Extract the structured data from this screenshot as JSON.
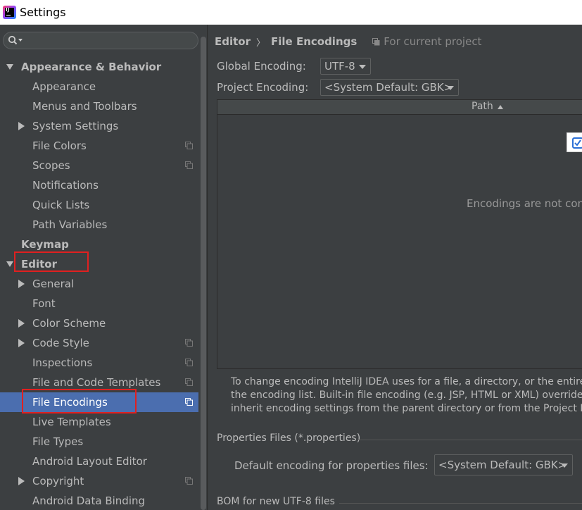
{
  "window": {
    "title": "Settings"
  },
  "search": {
    "placeholder": ""
  },
  "sidebar": {
    "items": [
      {
        "label": "Appearance & Behavior",
        "level": 0,
        "expanded": true,
        "bold": true
      },
      {
        "label": "Appearance",
        "level": 1
      },
      {
        "label": "Menus and Toolbars",
        "level": 1
      },
      {
        "label": "System Settings",
        "level": 1,
        "collapsed": true
      },
      {
        "label": "File Colors",
        "level": 1,
        "project_icon": true
      },
      {
        "label": "Scopes",
        "level": 1,
        "project_icon": true
      },
      {
        "label": "Notifications",
        "level": 1
      },
      {
        "label": "Quick Lists",
        "level": 1
      },
      {
        "label": "Path Variables",
        "level": 1
      },
      {
        "label": "Keymap",
        "level": 0,
        "bold": true
      },
      {
        "label": "Editor",
        "level": 0,
        "expanded": true,
        "bold": true,
        "highlighted": true
      },
      {
        "label": "General",
        "level": 1,
        "collapsed": true
      },
      {
        "label": "Font",
        "level": 1
      },
      {
        "label": "Color Scheme",
        "level": 1,
        "collapsed": true
      },
      {
        "label": "Code Style",
        "level": 1,
        "collapsed": true,
        "project_icon": true
      },
      {
        "label": "Inspections",
        "level": 1,
        "project_icon": true
      },
      {
        "label": "File and Code Templates",
        "level": 1,
        "project_icon": true
      },
      {
        "label": "File Encodings",
        "level": 1,
        "project_icon": true,
        "selected": true,
        "highlighted": true
      },
      {
        "label": "Live Templates",
        "level": 1
      },
      {
        "label": "File Types",
        "level": 1
      },
      {
        "label": "Android Layout Editor",
        "level": 1
      },
      {
        "label": "Copyright",
        "level": 1,
        "collapsed": true,
        "project_icon": true
      },
      {
        "label": "Android Data Binding",
        "level": 1
      }
    ]
  },
  "breadcrumb": {
    "parent": "Editor",
    "current": "File Encodings",
    "scope": "For current project"
  },
  "global_encoding": {
    "label": "Global Encoding:",
    "value": "UTF-8"
  },
  "project_encoding": {
    "label": "Project Encoding:",
    "value": "<System Default: GBK>"
  },
  "table": {
    "column_header": "Path",
    "empty_text": "Encodings are not conf"
  },
  "info": {
    "line1": "To change encoding IntelliJ IDEA uses for a file, a directory, or the entire p",
    "line2": "the encoding list. Built-in file encoding (e.g. JSP, HTML or XML) overrides e",
    "line3": "inherit encoding settings from the parent directory or from the Project Enc"
  },
  "properties": {
    "section_title": "Properties Files (*.properties)",
    "default_label": "Default encoding for properties files:",
    "default_value": "<System Default: GBK>"
  },
  "bom": {
    "section_title": "BOM for new UTF-8 files"
  },
  "colors": {
    "background": "#3c3f41",
    "selection": "#4b6eaf",
    "highlight_box": "#e02020"
  }
}
